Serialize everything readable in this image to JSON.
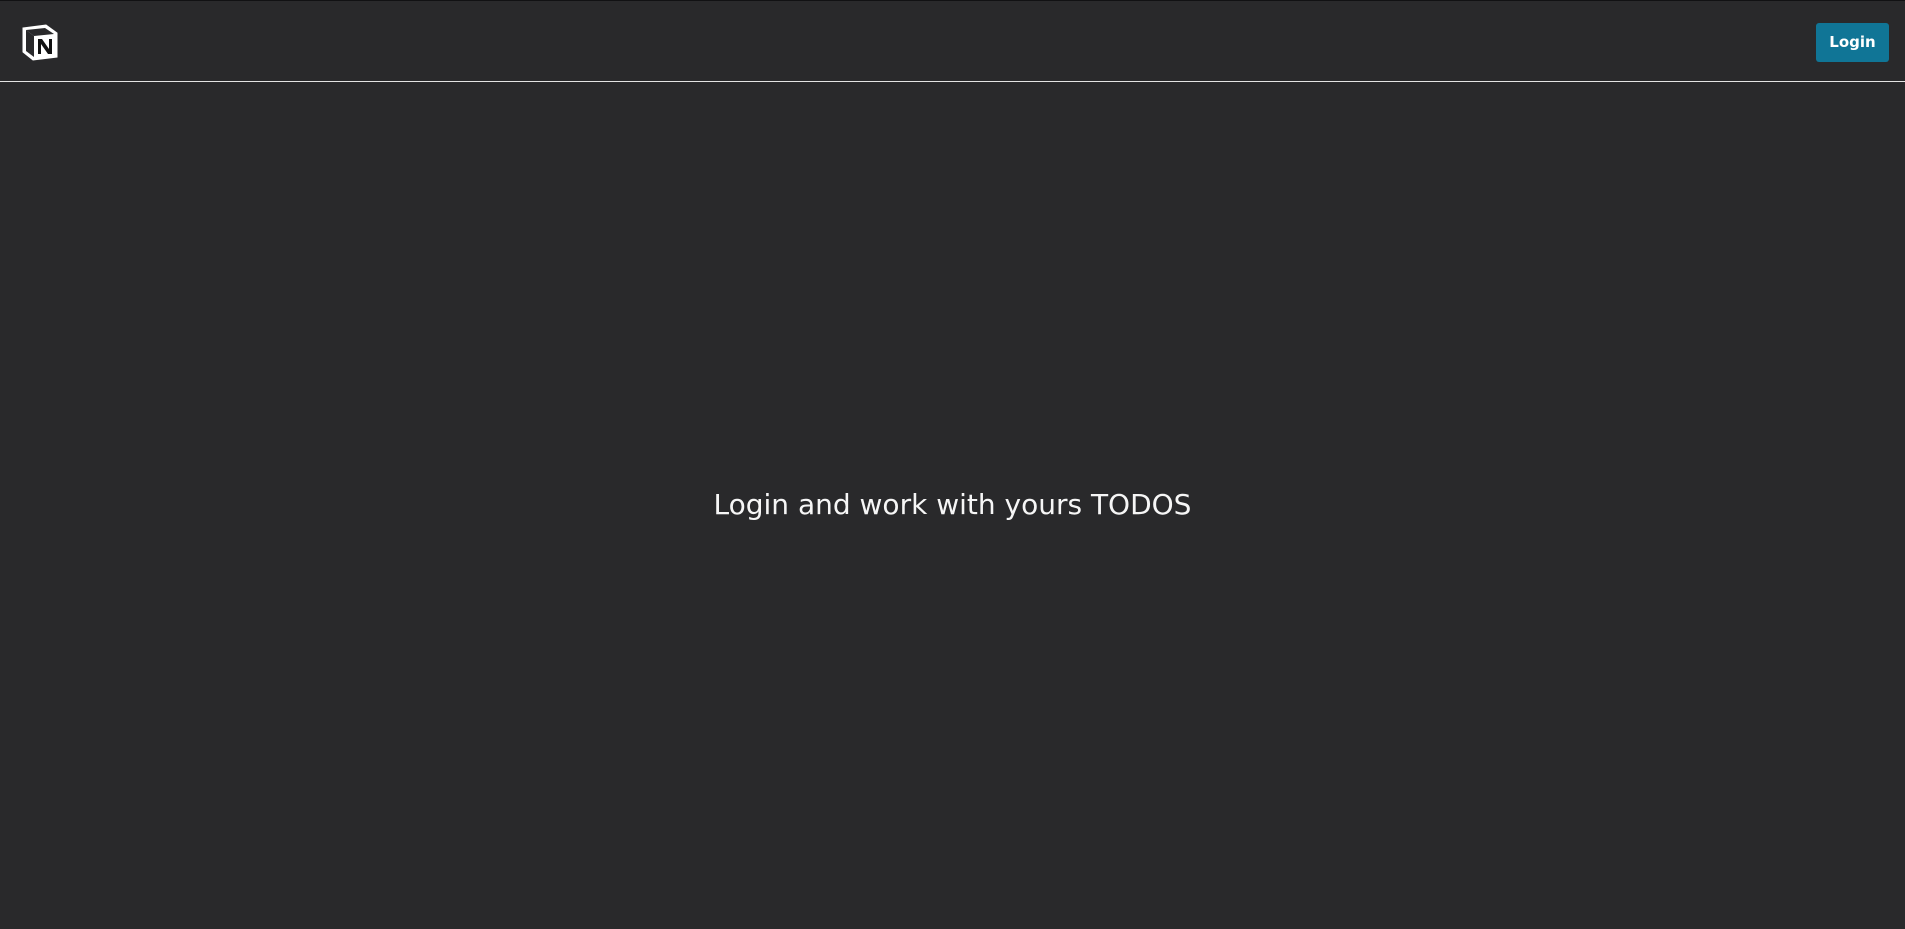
{
  "header": {
    "logo_icon": "notion-cube-logo-icon",
    "login_label": "Login"
  },
  "main": {
    "message": "Login and work with yours TODOS"
  },
  "colors": {
    "background": "#29292b",
    "header_divider": "#e4e4e4",
    "button_bg": "#107596",
    "button_text": "#ffffff",
    "message_text": "#f6f6f6"
  }
}
